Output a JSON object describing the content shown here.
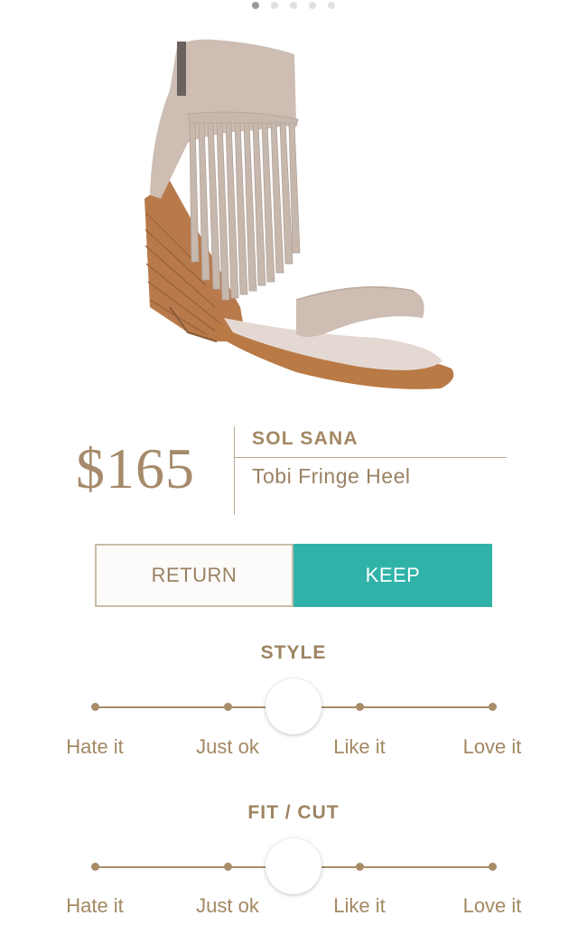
{
  "carousel": {
    "page_count": 5,
    "active_index": 0
  },
  "product": {
    "price": "$165",
    "brand": "SOL SANA",
    "name": "Tobi Fringe Heel"
  },
  "actions": {
    "return_label": "RETURN",
    "keep_label": "KEEP",
    "selected": "keep"
  },
  "ratings": [
    {
      "title": "STYLE",
      "options": [
        "Hate it",
        "Just ok",
        "Like it",
        "Love it"
      ],
      "value": 0.5
    },
    {
      "title": "FIT / CUT",
      "options": [
        "Hate it",
        "Just ok",
        "Like it",
        "Love it"
      ],
      "value": 0.5
    }
  ],
  "colors": {
    "accent": "#2fb3a8",
    "brand_tan": "#a58a6b"
  }
}
